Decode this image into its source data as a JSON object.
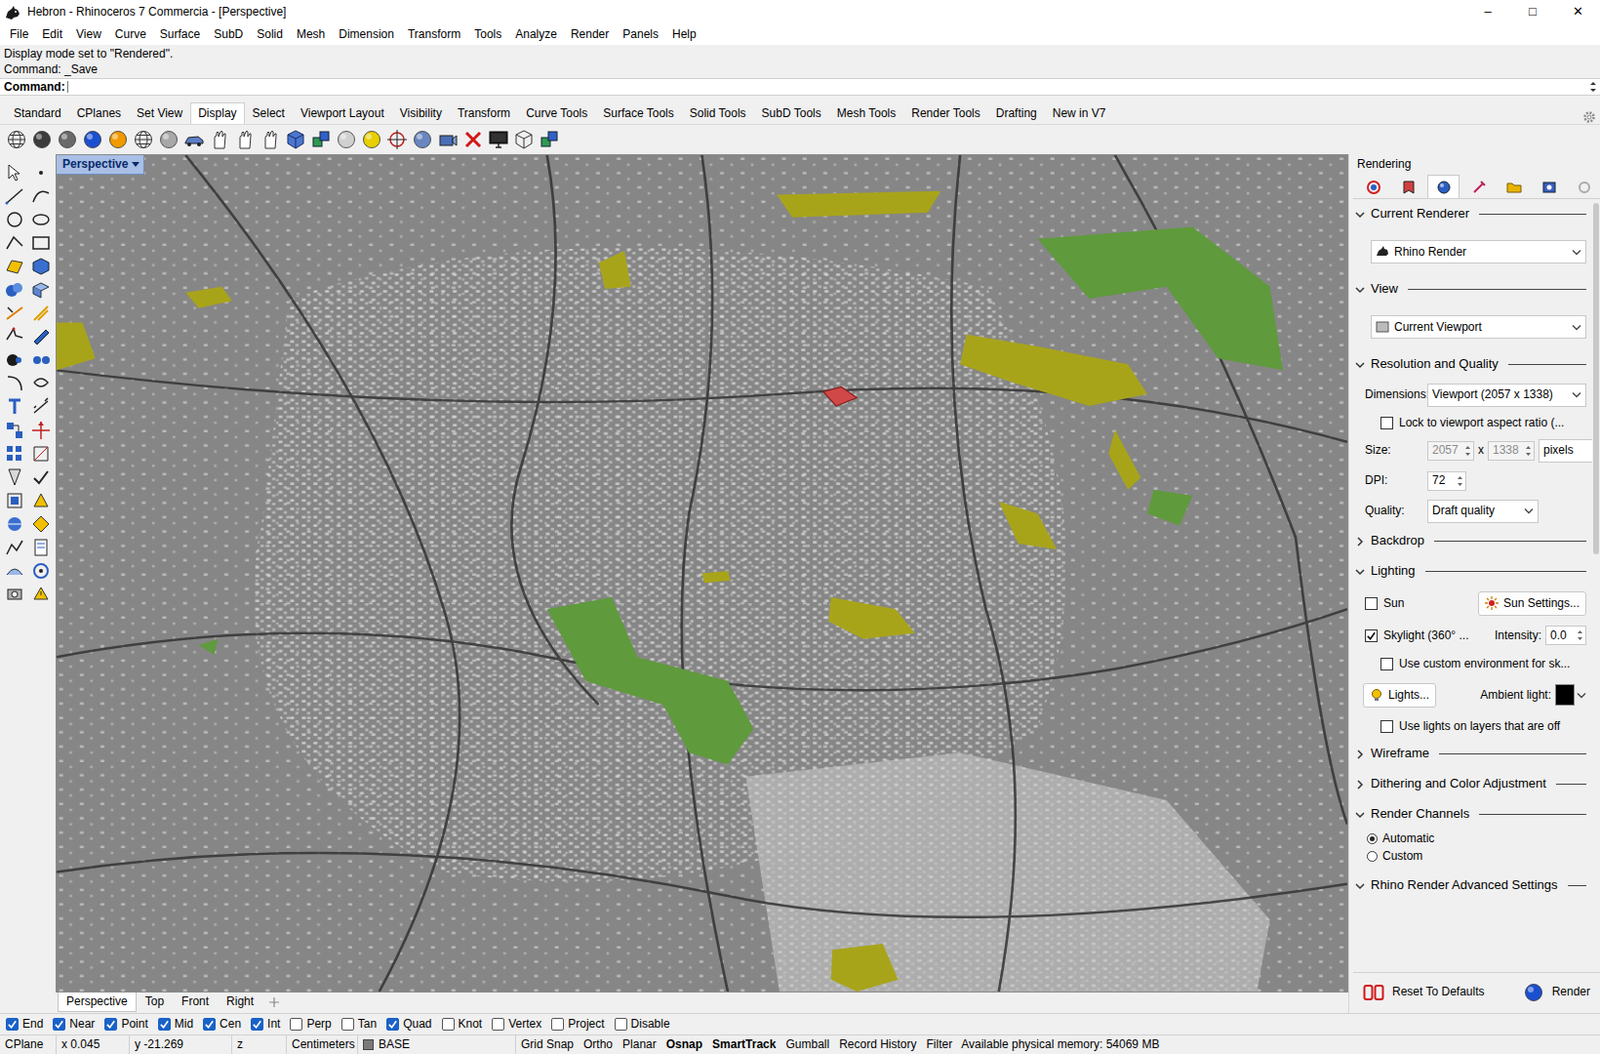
{
  "window": {
    "title": "Hebron - Rhinoceros 7 Commercia - [Perspective]",
    "controls": [
      "–",
      "□",
      "✕"
    ]
  },
  "menu": [
    "File",
    "Edit",
    "View",
    "Curve",
    "Surface",
    "SubD",
    "Solid",
    "Mesh",
    "Dimension",
    "Transform",
    "Tools",
    "Analyze",
    "Render",
    "Panels",
    "Help"
  ],
  "command": {
    "history": [
      "Display mode set to \"Rendered\".",
      "Command: _Save"
    ],
    "prompt": "Command:"
  },
  "toolbar_tabs": [
    {
      "label": "Standard",
      "selected": false
    },
    {
      "label": "CPlanes",
      "selected": false
    },
    {
      "label": "Set View",
      "selected": false
    },
    {
      "label": "Display",
      "selected": true
    },
    {
      "label": "Select",
      "selected": false
    },
    {
      "label": "Viewport Layout",
      "selected": false
    },
    {
      "label": "Visibility",
      "selected": false
    },
    {
      "label": "Transform",
      "selected": false
    },
    {
      "label": "Curve Tools",
      "selected": false
    },
    {
      "label": "Surface Tools",
      "selected": false
    },
    {
      "label": "Solid Tools",
      "selected": false
    },
    {
      "label": "SubD Tools",
      "selected": false
    },
    {
      "label": "Mesh Tools",
      "selected": false
    },
    {
      "label": "Render Tools",
      "selected": false
    },
    {
      "label": "Drafting",
      "selected": false
    },
    {
      "label": "New in V7",
      "selected": false
    }
  ],
  "viewport": {
    "label": "Perspective"
  },
  "viewport_tabs": [
    {
      "label": "Perspective",
      "selected": true
    },
    {
      "label": "Top",
      "selected": false
    },
    {
      "label": "Front",
      "selected": false
    },
    {
      "label": "Right",
      "selected": false
    }
  ],
  "panel": {
    "title": "Rendering",
    "tabs": [
      {
        "selected": false
      },
      {
        "selected": false
      },
      {
        "selected": true
      },
      {
        "selected": false
      },
      {
        "selected": false
      },
      {
        "selected": false
      },
      {
        "selected": false
      }
    ],
    "sections": [
      {
        "kind": "dropdown",
        "title": "Current Renderer",
        "expanded": true,
        "value": "Rhino Render"
      },
      {
        "kind": "dropdown",
        "title": "View",
        "expanded": true,
        "value": "Current Viewport"
      },
      {
        "kind": "resolution",
        "title": "Resolution and Quality",
        "expanded": true,
        "dimensions_label": "Dimensions:",
        "dimensions": "Viewport (2057 x 1338)",
        "lock": {
          "label": "Lock to viewport aspect ratio (...",
          "checked": false
        },
        "size_label": "Size:",
        "width": "2057",
        "by": "x",
        "height": "1338",
        "size_disabled": true,
        "unit": "pixels",
        "dpi_label": "DPI:",
        "dpi": "72",
        "quality_label": "Quality:",
        "quality": "Draft quality"
      },
      {
        "kind": "collapsed",
        "title": "Backdrop",
        "expanded": false
      },
      {
        "kind": "lighting",
        "title": "Lighting",
        "expanded": true,
        "sun": {
          "label": "Sun",
          "checked": false
        },
        "sun_settings": "Sun Settings...",
        "skylight": {
          "label": "Skylight (360° ...",
          "checked": true
        },
        "intensity_label": "Intensity:",
        "intensity": "0.0",
        "custom_env": {
          "label": "Use custom environment for sk...",
          "checked": false
        },
        "lights": "Lights...",
        "ambient_label": "Ambient light:",
        "ambient_color": "#000000",
        "use_lights_off": {
          "label": "Use lights on layers that are off",
          "checked": false
        }
      },
      {
        "kind": "collapsed",
        "title": "Wireframe",
        "expanded": false
      },
      {
        "kind": "collapsed",
        "title": "Dithering and Color Adjustment",
        "expanded": false
      },
      {
        "kind": "radios",
        "title": "Render Channels",
        "expanded": true,
        "options": [
          {
            "label": "Automatic",
            "selected": true
          },
          {
            "label": "Custom",
            "selected": false
          }
        ]
      },
      {
        "kind": "collapsed",
        "title": "Rhino Render Advanced Settings",
        "expanded": true
      }
    ],
    "reset": "Reset To Defaults",
    "render": "Render"
  },
  "osnaps": [
    {
      "label": "End",
      "checked": true
    },
    {
      "label": "Near",
      "checked": true
    },
    {
      "label": "Point",
      "checked": true
    },
    {
      "label": "Mid",
      "checked": true
    },
    {
      "label": "Cen",
      "checked": true
    },
    {
      "label": "Int",
      "checked": true
    },
    {
      "label": "Perp",
      "checked": false
    },
    {
      "label": "Tan",
      "checked": false
    },
    {
      "label": "Quad",
      "checked": true
    },
    {
      "label": "Knot",
      "checked": false
    },
    {
      "label": "Vertex",
      "checked": false
    },
    {
      "label": "Project",
      "checked": false
    },
    {
      "label": "Disable",
      "checked": false
    }
  ],
  "status_bar": {
    "cplane": "CPlane",
    "coords": [
      "x 0.045",
      "y -21.269",
      "z"
    ],
    "units": "Centimeters",
    "layer": "BASE",
    "toggles": [
      {
        "label": "Grid Snap",
        "on": false
      },
      {
        "label": "Ortho",
        "on": false
      },
      {
        "label": "Planar",
        "on": false
      },
      {
        "label": "Osnap",
        "on": true
      },
      {
        "label": "SmartTrack",
        "on": true
      },
      {
        "label": "Gumball",
        "on": false
      },
      {
        "label": "Record History",
        "on": false
      },
      {
        "label": "Filter",
        "on": false
      }
    ],
    "memory": "Available physical memory: 54069 MB"
  }
}
